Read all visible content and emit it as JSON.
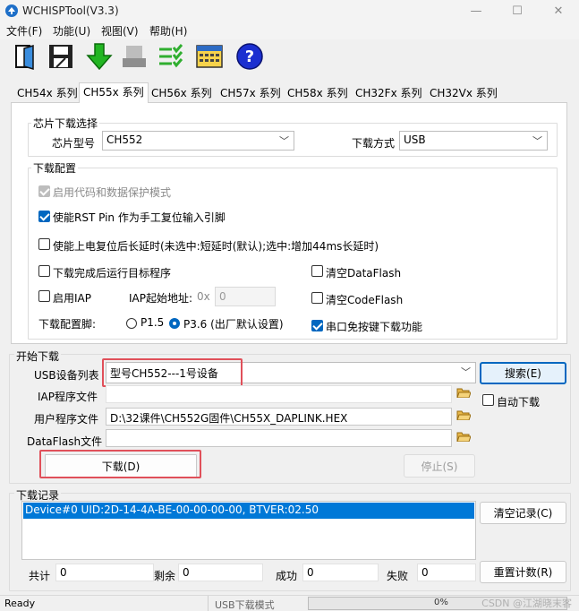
{
  "window": {
    "title": "WCHISPTool(V3.3)"
  },
  "menu": [
    "文件(F)",
    "功能(U)",
    "视图(V)",
    "帮助(H)"
  ],
  "tabs": [
    "CH54x 系列",
    "CH55x 系列",
    "CH56x 系列",
    "CH57x 系列",
    "CH58x 系列",
    "CH32Fx 系列",
    "CH32Vx 系列"
  ],
  "chip_select": {
    "title": "芯片下载选择",
    "model_label": "芯片型号",
    "model_value": "CH552",
    "mode_label": "下载方式",
    "mode_value": "USB"
  },
  "download_config": {
    "title": "下载配置",
    "protect": "启用代码和数据保护模式",
    "rst_pin": "使能RST Pin 作为手工复位输入引脚",
    "long_delay": "使能上电复位后长延时(未选中:短延时(默认);选中:增加44ms长延时)",
    "run_after": "下载完成后运行目标程序",
    "clear_dataflash": "清空DataFlash",
    "enable_iap": "启用IAP",
    "iap_addr_label": "IAP起始地址:",
    "iap_addr_prefix": "0x",
    "iap_addr_value": "0",
    "clear_codeflash": "清空CodeFlash",
    "pin_label": "下载配置脚:",
    "pin_opt1": "P1.5",
    "pin_opt2": "P3.6 (出厂默认设置)",
    "serial_nokey": "串口免按键下载功能"
  },
  "start": {
    "title": "开始下载",
    "usb_label": "USB设备列表",
    "usb_value": "型号CH552---1号设备",
    "search": "搜索(E)",
    "iap_label": "IAP程序文件",
    "iap_value": "",
    "auto_dl": "自动下载",
    "user_label": "用户程序文件",
    "user_value": "D:\\32课件\\CH552G固件\\CH55X_DAPLINK.HEX",
    "df_label": "DataFlash文件",
    "df_value": "",
    "download": "下载(D)",
    "stop": "停止(S)"
  },
  "log": {
    "title": "下载记录",
    "entries": [
      "Device#0  UID:2D-14-4A-BE-00-00-00-00, BTVER:02.50"
    ],
    "clear": "清空记录(C)",
    "total_label": "共计",
    "total": "0",
    "remain_label": "剩余",
    "remain": "0",
    "ok_label": "成功",
    "ok": "0",
    "fail_label": "失败",
    "fail": "0",
    "reset": "重置计数(R)"
  },
  "status": {
    "left": "Ready",
    "mode": "USB下载模式",
    "progress": "0%",
    "progress_value": 0,
    "watermark": "CSDN @江湖晓末客"
  },
  "colors": {
    "accent": "#0067c0",
    "highlight_box": "#e0505a",
    "selection": "#0078d7"
  }
}
